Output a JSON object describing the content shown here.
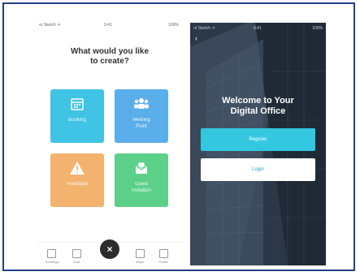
{
  "left_screen": {
    "status": {
      "carrier": "•ıl Sketch ᯤ",
      "time": "9:41",
      "battery": "100%"
    },
    "title": "What would you like\nto create?",
    "tiles": [
      {
        "label": "Booking",
        "icon": "calendar-icon",
        "color": "#3fc4e6"
      },
      {
        "label": "Meeting\nPoint",
        "icon": "group-icon",
        "color": "#5aaee9"
      },
      {
        "label": "Feedback",
        "icon": "warning-icon",
        "color": "#f4b26f"
      },
      {
        "label": "Guest\ninvitation",
        "icon": "mail-icon",
        "color": "#5cd089"
      }
    ],
    "bottom_nav": [
      {
        "label": "Bookings",
        "icon": "calendar-nav-icon"
      },
      {
        "label": "Chat",
        "icon": "chat-nav-icon"
      },
      {
        "label": "Maps",
        "icon": "map-nav-icon"
      },
      {
        "label": "Profile",
        "icon": "profile-nav-icon"
      }
    ],
    "fab_symbol": "×"
  },
  "right_screen": {
    "status": {
      "carrier": "•ıl Sketch ᯤ",
      "time": "9:41",
      "battery": "100%"
    },
    "back_symbol": "‹",
    "welcome": "Welcome to Your\nDigital Office",
    "register_label": "Register",
    "login_label": "Login",
    "accent": "#33c7e0"
  }
}
